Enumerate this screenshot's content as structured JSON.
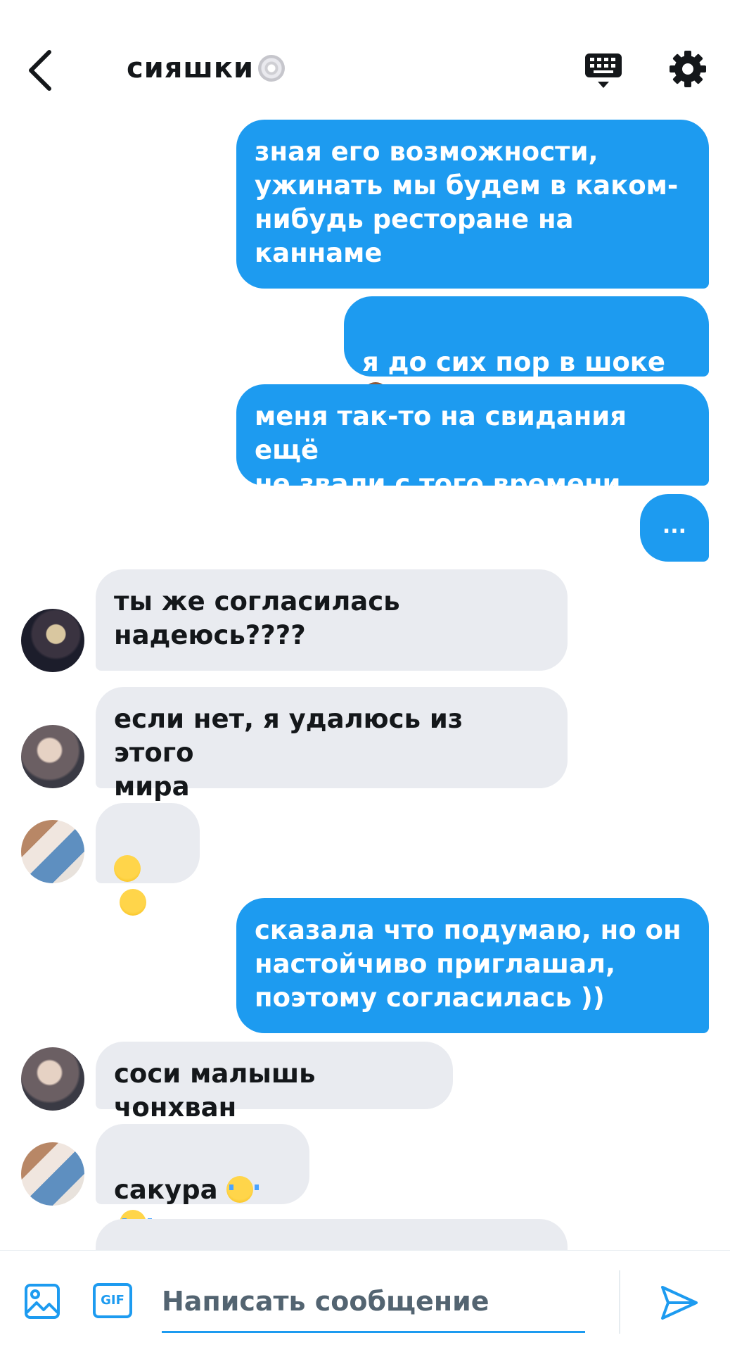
{
  "header": {
    "title": "сияшки",
    "title_emoji": "cd-icon"
  },
  "messages": [
    {
      "side": "out",
      "text": "зная его возможности,\nужинать мы будем в каком-\nнибудь ресторане на\nканнаме"
    },
    {
      "side": "out",
      "text": "я до сих пор в шоке "
    },
    {
      "side": "out",
      "text": "меня так-то на свидания ещё\nне звали с того времени"
    },
    {
      "side": "out",
      "text": "..."
    },
    {
      "side": "in",
      "text": "ты же согласилась\nнадеюсь????"
    },
    {
      "side": "in",
      "text": "если нет, я удалюсь из этого\nмира"
    },
    {
      "side": "in",
      "text": ""
    },
    {
      "side": "out",
      "text": "сказала что подумаю, но он\nнастойчиво приглашал,\nпоэтому согласилась ))"
    },
    {
      "side": "in",
      "text": "соси малышь чонхван"
    },
    {
      "side": "in",
      "text": "сакура "
    }
  ],
  "composer": {
    "gif_label": "GIF",
    "placeholder": "Написать сообщение"
  },
  "colors": {
    "accent": "#1d9bf0",
    "incoming_bubble": "#e9ebf0"
  }
}
